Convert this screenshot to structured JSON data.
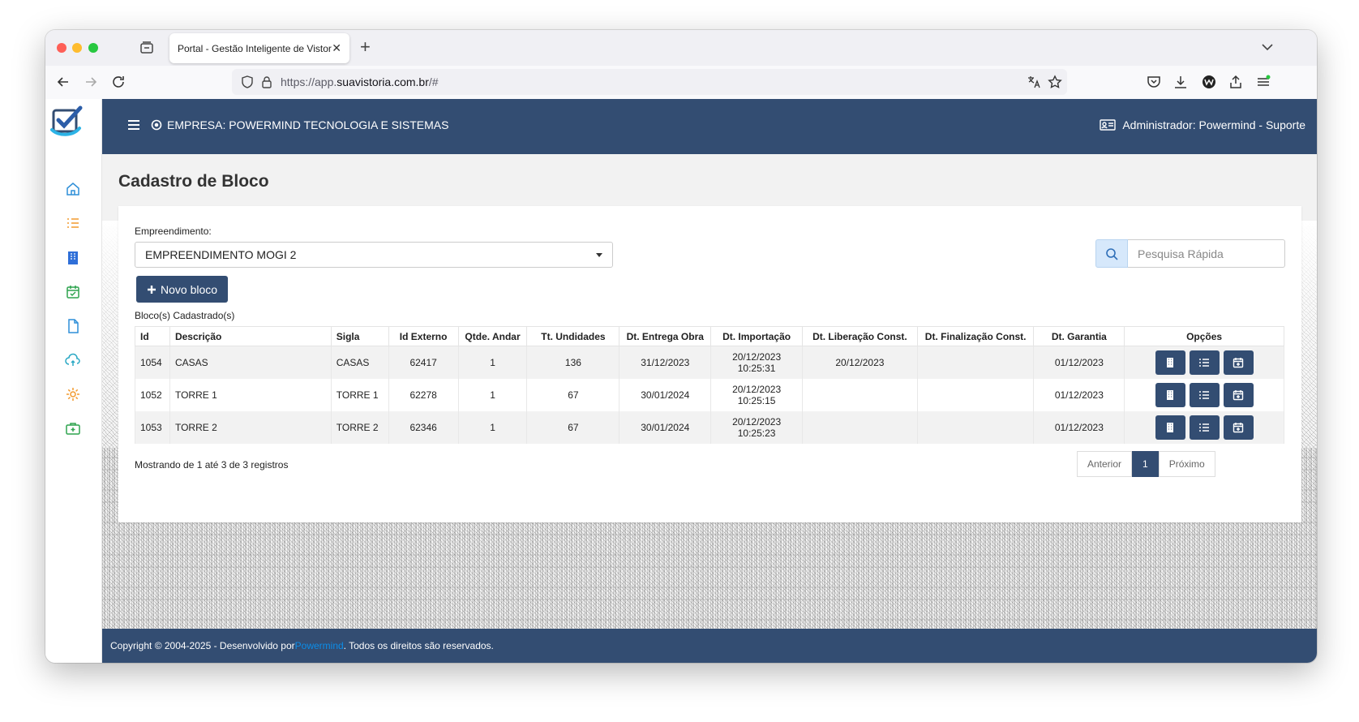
{
  "browser": {
    "tab_title": "Portal - Gestão Inteligente de Vistorias",
    "tab_close": "✕",
    "new_tab": "+",
    "url_prefix": "https://app.",
    "url_domain": "suavistoria.com.br",
    "url_suffix": "/#"
  },
  "topbar": {
    "company": "EMPRESA: POWERMIND TECNOLOGIA E SISTEMAS",
    "admin": "Administrador: Powermind - Suporte"
  },
  "page": {
    "title": "Cadastro de Bloco",
    "empreendimento_label": "Empreendimento:",
    "empreendimento_value": "EMPREENDIMENTO MOGI 2",
    "search_placeholder": "Pesquisa Rápida",
    "new_button": "Novo bloco",
    "list_label": "Bloco(s) Cadastrado(s)",
    "showing": "Mostrando de 1 até 3 de 3 registros"
  },
  "table": {
    "headers": [
      "Id",
      "Descrição",
      "Sigla",
      "Id Externo",
      "Qtde. Andar",
      "Tt. Undidades",
      "Dt. Entrega Obra",
      "Dt. Importação",
      "Dt. Liberação Const.",
      "Dt. Finalização Const.",
      "Dt. Garantia",
      "Opções"
    ],
    "rows": [
      {
        "id": "1054",
        "descricao": "CASAS",
        "sigla": "CASAS",
        "id_externo": "62417",
        "qtde_andar": "1",
        "tt_unidades": "136",
        "dt_entrega": "31/12/2023",
        "dt_importacao_date": "20/12/2023",
        "dt_importacao_time": "10:25:31",
        "dt_liberacao": "20/12/2023",
        "dt_finalizacao": "",
        "dt_garantia": "01/12/2023"
      },
      {
        "id": "1052",
        "descricao": "TORRE 1",
        "sigla": "TORRE 1",
        "id_externo": "62278",
        "qtde_andar": "1",
        "tt_unidades": "67",
        "dt_entrega": "30/01/2024",
        "dt_importacao_date": "20/12/2023",
        "dt_importacao_time": "10:25:15",
        "dt_liberacao": "",
        "dt_finalizacao": "",
        "dt_garantia": "01/12/2023"
      },
      {
        "id": "1053",
        "descricao": "TORRE 2",
        "sigla": "TORRE 2",
        "id_externo": "62346",
        "qtde_andar": "1",
        "tt_unidades": "67",
        "dt_entrega": "30/01/2024",
        "dt_importacao_date": "20/12/2023",
        "dt_importacao_time": "10:25:23",
        "dt_liberacao": "",
        "dt_finalizacao": "",
        "dt_garantia": "01/12/2023"
      }
    ]
  },
  "pagination": {
    "prev": "Anterior",
    "current": "1",
    "next": "Próximo"
  },
  "footer": {
    "before": "Copyright © 2004-2025 - Desenvolvido por ",
    "brand": "Powermind",
    "after": ". Todos os direitos são reservados."
  },
  "colors": {
    "primary": "#334d72",
    "search_addon": "#d6e8fb",
    "footer_link": "#0c8de8"
  },
  "icons": {
    "sidebar": [
      "home-icon",
      "list-icon",
      "building-icon",
      "calendar-check-icon",
      "document-icon",
      "cloud-upload-icon",
      "settings-icon",
      "medical-kit-icon"
    ],
    "row_options": [
      "building-icon",
      "list-icon",
      "calendar-plus-icon"
    ]
  }
}
